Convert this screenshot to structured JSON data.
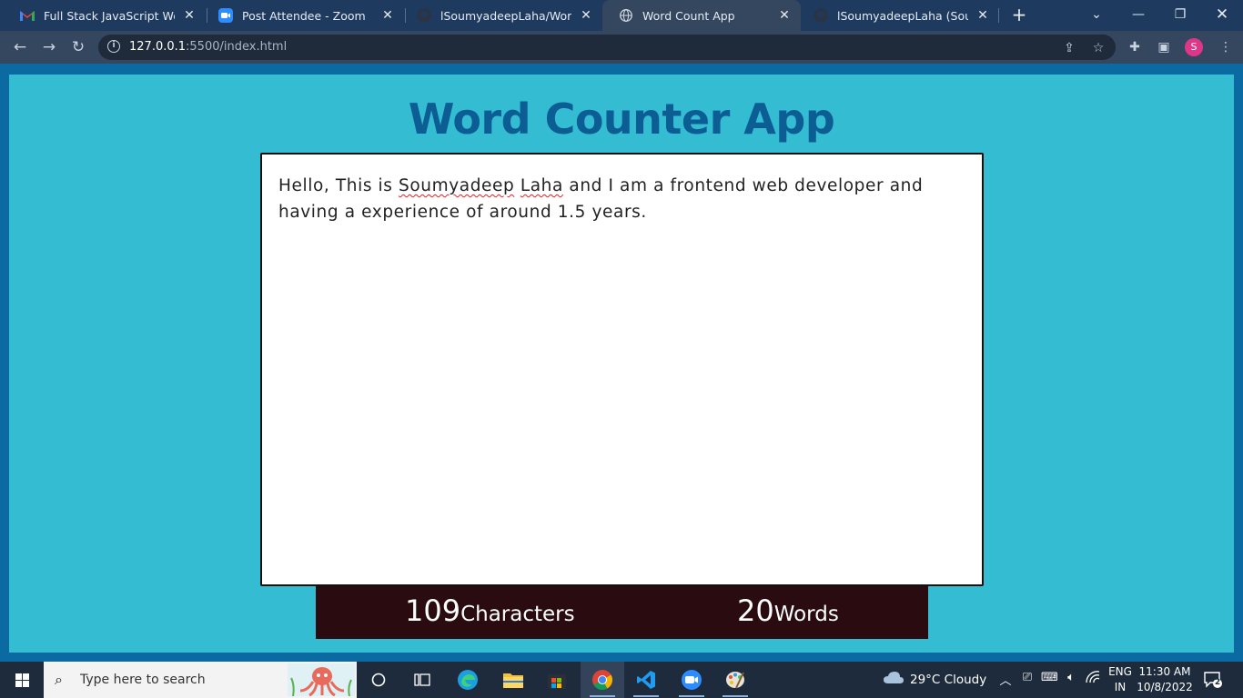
{
  "browser": {
    "tabs": [
      {
        "title": "Full Stack JavaScript Web Dev",
        "icon": "gmail-icon",
        "active": false
      },
      {
        "title": "Post Attendee - Zoom",
        "icon": "zoom-icon",
        "active": false
      },
      {
        "title": "lSoumyadeepLaha/WordCou",
        "icon": "github-icon",
        "active": false
      },
      {
        "title": "Word Count App",
        "icon": "globe-icon",
        "active": true
      },
      {
        "title": "lSoumyadeepLaha (Soumyad",
        "icon": "github-icon",
        "active": false
      }
    ],
    "url_host": "127.0.0.1",
    "url_rest": ":5500/index.html",
    "profile_initial": "S",
    "colors": {
      "tabstrip": "#1e3a5f",
      "toolbar": "#35465f"
    }
  },
  "app": {
    "title": "Word Counter App",
    "text_before": "Hello, This is ",
    "text_spell_1": "Soumyadeep",
    "text_space": " ",
    "text_spell_2": "Laha",
    "text_after": " and I am a frontend web developer and having a experience of around 1.5 years.",
    "characters_count": "109",
    "characters_label": "Characters",
    "words_count": "20",
    "words_label": "Words",
    "colors": {
      "background": "#34bcd2",
      "title": "#0b5d93",
      "stats_bar": "#2a0c10"
    }
  },
  "taskbar": {
    "search_placeholder": "Type here to search",
    "weather": "29°C  Cloudy",
    "language_top": "ENG",
    "language_bottom": "IN",
    "time": "11:30 AM",
    "date": "10/8/2022",
    "notification_count": "2"
  }
}
